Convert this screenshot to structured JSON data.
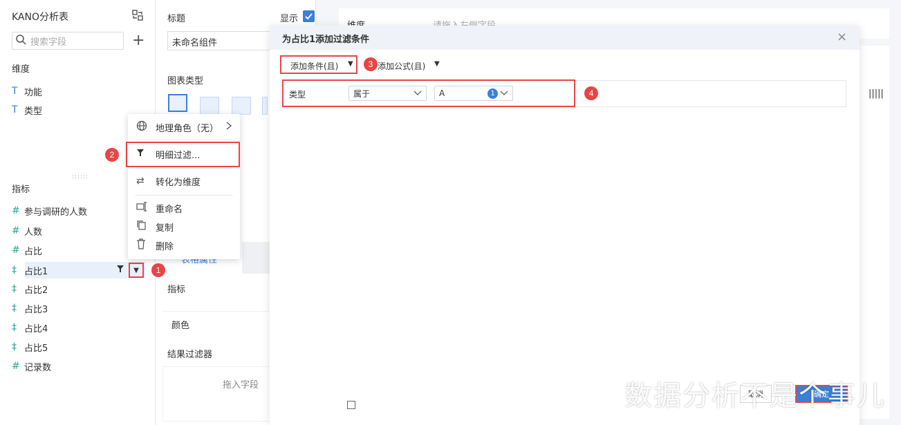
{
  "left_panel": {
    "title": "KANO分析表",
    "search_placeholder": "搜索字段",
    "dimension_label": "维度",
    "dimensions": [
      "功能",
      "类型"
    ],
    "metric_label": "指标",
    "metrics": [
      "参与调研的人数",
      "人数",
      "占比",
      "占比1",
      "占比2",
      "占比3",
      "占比4",
      "占比5",
      "记录数"
    ]
  },
  "config_panel": {
    "title_label": "标题",
    "show_label": "显示",
    "component_name": "未命名组件",
    "chart_type_label": "图表类型",
    "table_attr_label": "表格属性",
    "metric_label": "指标",
    "color_label": "颜色",
    "result_filter_label": "结果过滤器",
    "drop_field_label": "拖入字段"
  },
  "right_panel": {
    "dimension_label": "维度",
    "drop_hint": "请拖入左侧字段"
  },
  "context_menu": {
    "items": [
      "地理角色（无）",
      "明细过滤...",
      "转化为维度",
      "重命名",
      "复制",
      "删除"
    ]
  },
  "dialog": {
    "title": "为占比1添加过滤条件",
    "add_condition": "添加条件(且)",
    "add_formula": "添加公式(且)",
    "condition": {
      "field": "类型",
      "operator": "属于",
      "value": "A",
      "count": "1"
    },
    "cancel_label": "取消",
    "ok_label": "确定"
  },
  "badges": [
    "1",
    "2",
    "3",
    "4"
  ],
  "watermark": "数据分析不是个事儿",
  "colors": {
    "accent": "#3b7fd8",
    "highlight_red": "#e84545"
  }
}
